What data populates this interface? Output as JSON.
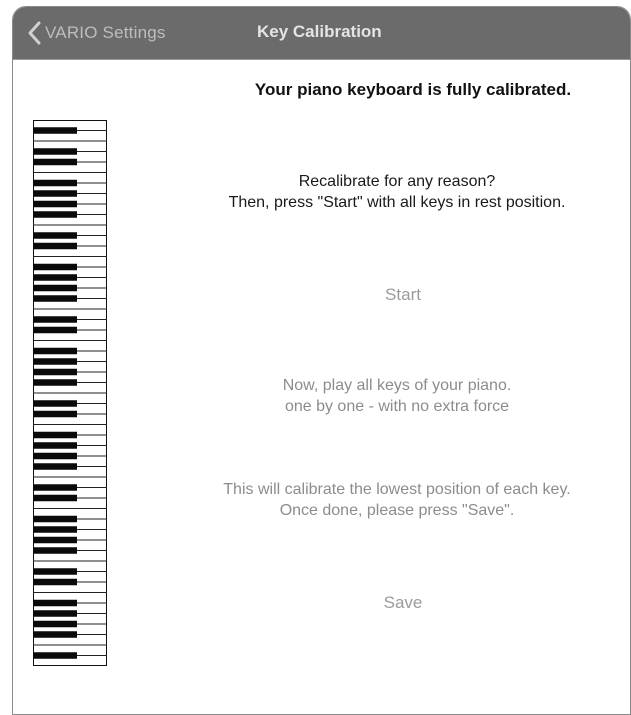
{
  "navbar": {
    "back_label": "VARIO Settings",
    "title": "Key Calibration"
  },
  "main": {
    "heading": "Your piano keyboard is fully calibrated.",
    "recalibrate_line1": "Recalibrate for any reason?",
    "recalibrate_line2": "Then, press \"Start\" with all keys in rest position.",
    "start_label": "Start",
    "play_line1": "Now, play all keys of your piano.",
    "play_line2": "one by one - with no extra force",
    "calibrate_line1": "This will calibrate the lowest position of each key.",
    "calibrate_line2": "Once done, please press \"Save\".",
    "save_label": "Save"
  },
  "keyboard": {
    "white_keys": 52,
    "black_key_pattern": [
      1,
      0,
      1,
      1,
      0,
      1,
      1,
      1
    ]
  },
  "colors": {
    "navbar": "#6b6b6b",
    "nav_title": "#e4e4e4",
    "back_label": "#bdbdbd",
    "disabled_text": "#9b9b9b"
  },
  "icons": {
    "back": "chevron-left-icon"
  }
}
